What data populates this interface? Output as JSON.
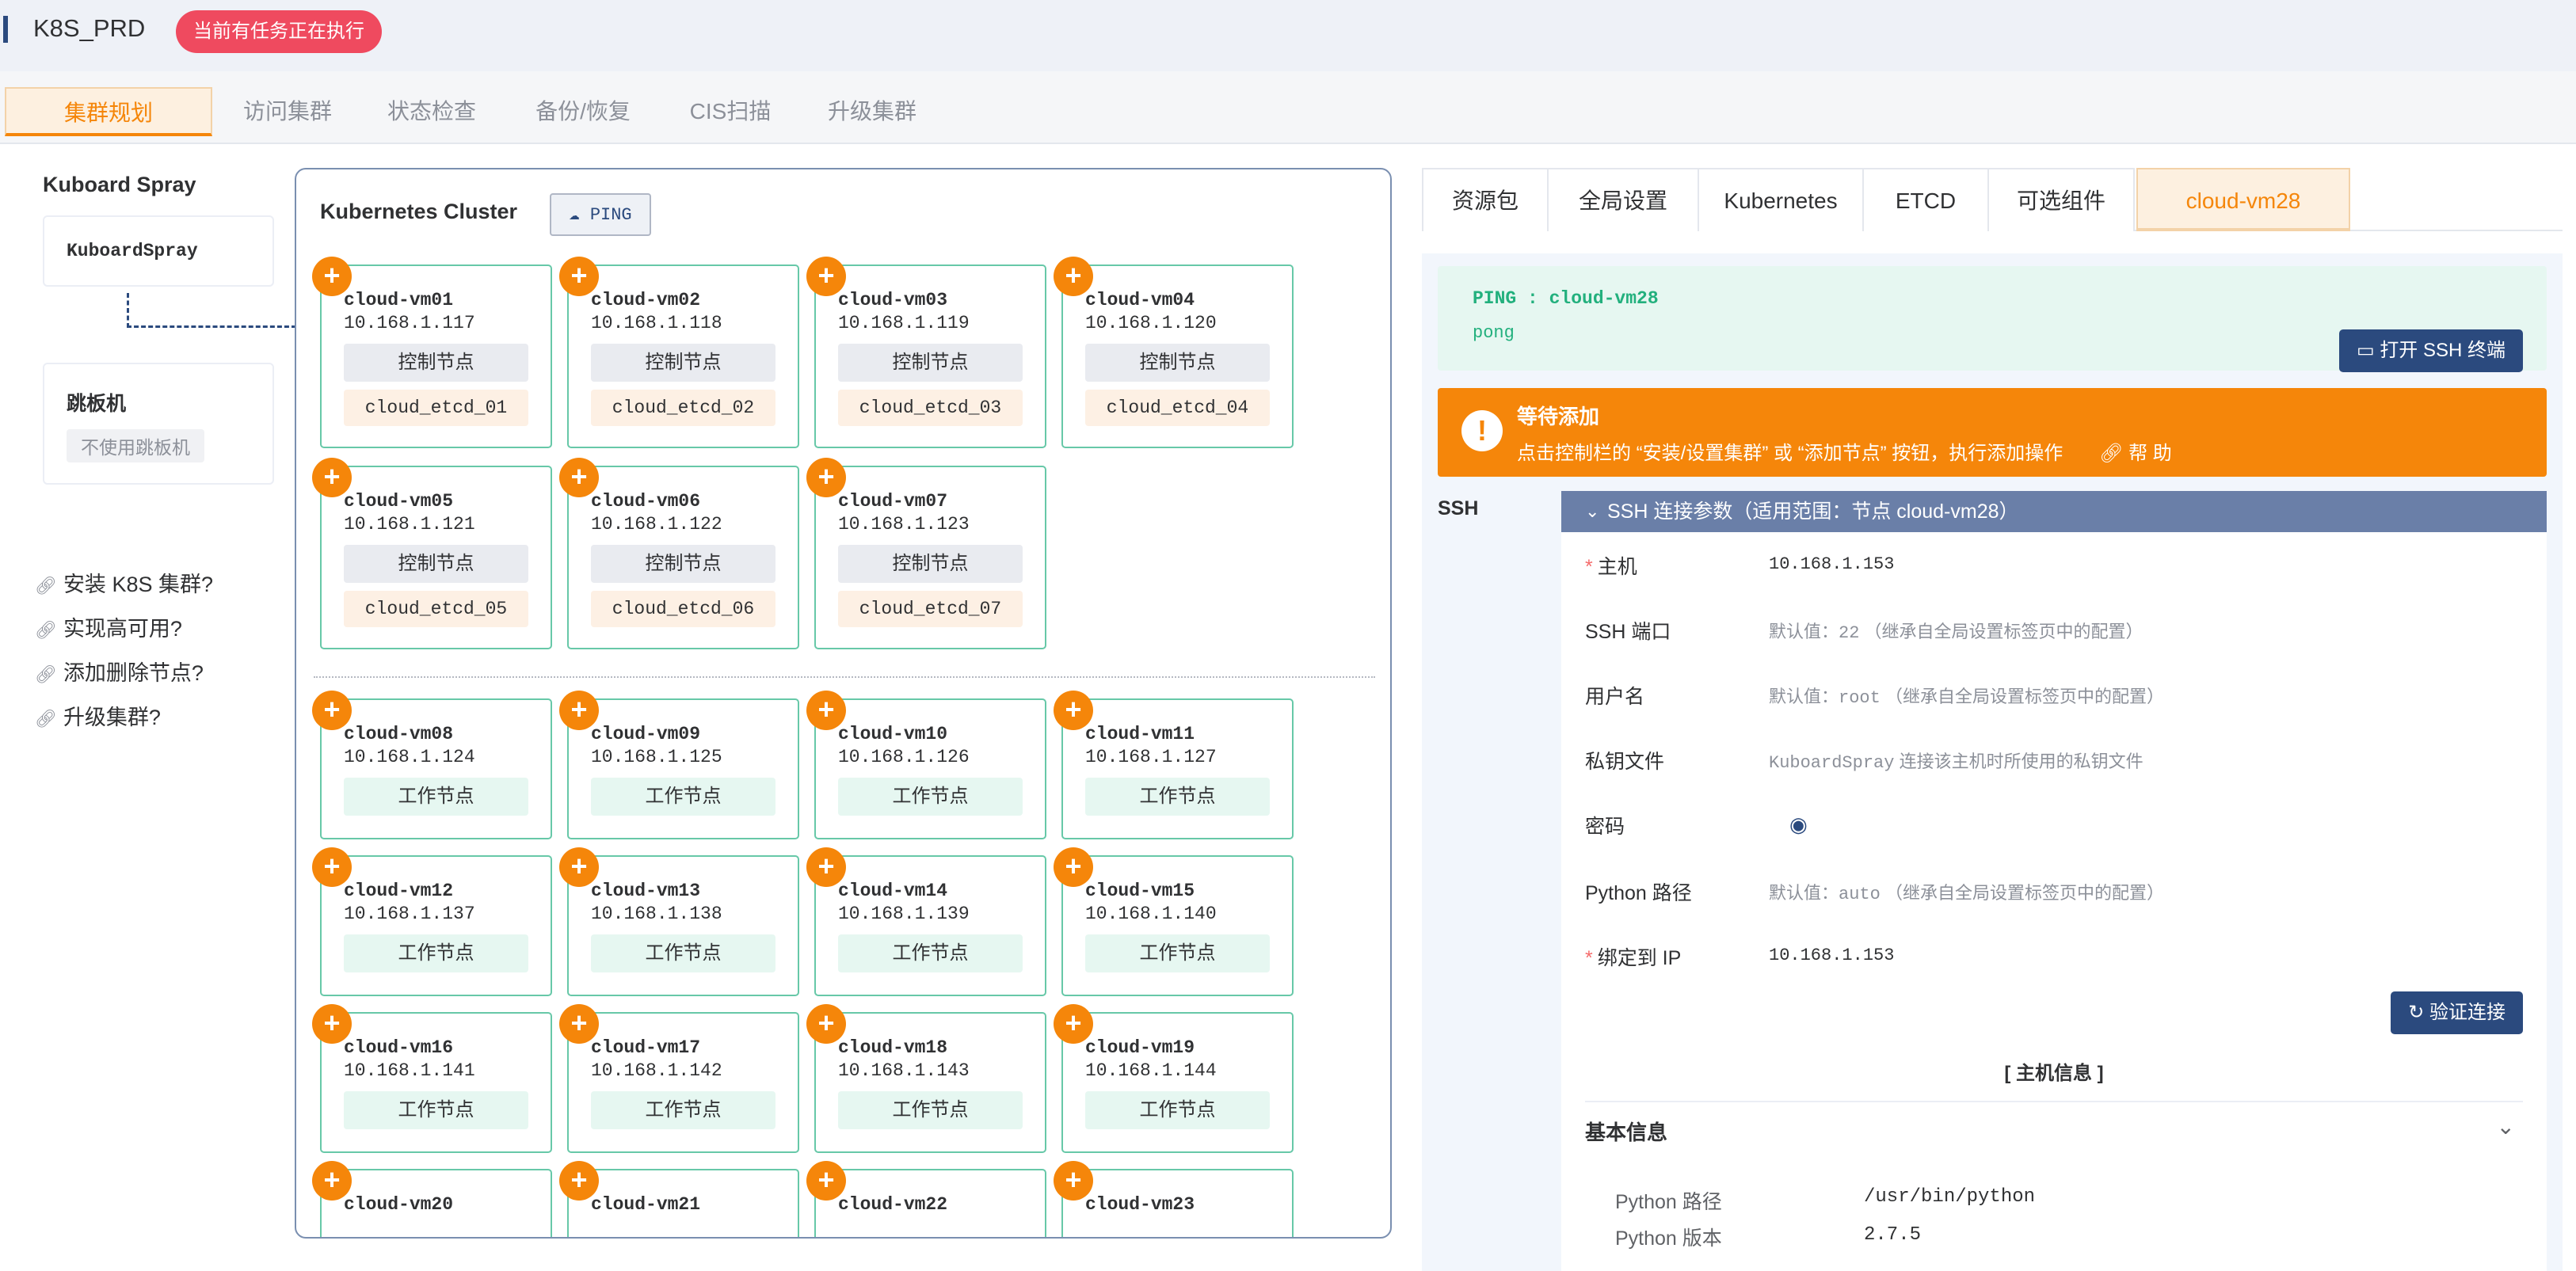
{
  "header": {
    "title": "K8S_PRD",
    "badge": "当前有任务正在执行"
  },
  "top_tabs": [
    "集群规划",
    "访问集群",
    "状态检查",
    "备份/恢复",
    "CIS扫描",
    "升级集群"
  ],
  "left": {
    "title": "Kuboard Spray",
    "kuboardspray_box": "KuboardSpray",
    "jump_title": "跳板机",
    "jump_tag": "不使用跳板机",
    "links": [
      "安装 K8S 集群?",
      "实现高可用?",
      "添加删除节点?",
      "升级集群?"
    ]
  },
  "cluster": {
    "title": "Kubernetes Cluster",
    "ping_label": "PING",
    "control_nodes": [
      {
        "name": "cloud-vm01",
        "ip": "10.168.1.117",
        "role": "控制节点",
        "etcd": "cloud_etcd_01"
      },
      {
        "name": "cloud-vm02",
        "ip": "10.168.1.118",
        "role": "控制节点",
        "etcd": "cloud_etcd_02"
      },
      {
        "name": "cloud-vm03",
        "ip": "10.168.1.119",
        "role": "控制节点",
        "etcd": "cloud_etcd_03"
      },
      {
        "name": "cloud-vm04",
        "ip": "10.168.1.120",
        "role": "控制节点",
        "etcd": "cloud_etcd_04"
      },
      {
        "name": "cloud-vm05",
        "ip": "10.168.1.121",
        "role": "控制节点",
        "etcd": "cloud_etcd_05"
      },
      {
        "name": "cloud-vm06",
        "ip": "10.168.1.122",
        "role": "控制节点",
        "etcd": "cloud_etcd_06"
      },
      {
        "name": "cloud-vm07",
        "ip": "10.168.1.123",
        "role": "控制节点",
        "etcd": "cloud_etcd_07"
      }
    ],
    "worker_nodes": [
      {
        "name": "cloud-vm08",
        "ip": "10.168.1.124",
        "role": "工作节点"
      },
      {
        "name": "cloud-vm09",
        "ip": "10.168.1.125",
        "role": "工作节点"
      },
      {
        "name": "cloud-vm10",
        "ip": "10.168.1.126",
        "role": "工作节点"
      },
      {
        "name": "cloud-vm11",
        "ip": "10.168.1.127",
        "role": "工作节点"
      },
      {
        "name": "cloud-vm12",
        "ip": "10.168.1.137",
        "role": "工作节点"
      },
      {
        "name": "cloud-vm13",
        "ip": "10.168.1.138",
        "role": "工作节点"
      },
      {
        "name": "cloud-vm14",
        "ip": "10.168.1.139",
        "role": "工作节点"
      },
      {
        "name": "cloud-vm15",
        "ip": "10.168.1.140",
        "role": "工作节点"
      },
      {
        "name": "cloud-vm16",
        "ip": "10.168.1.141",
        "role": "工作节点"
      },
      {
        "name": "cloud-vm17",
        "ip": "10.168.1.142",
        "role": "工作节点"
      },
      {
        "name": "cloud-vm18",
        "ip": "10.168.1.143",
        "role": "工作节点"
      },
      {
        "name": "cloud-vm19",
        "ip": "10.168.1.144",
        "role": "工作节点"
      },
      {
        "name": "cloud-vm20",
        "ip": "",
        "role": ""
      },
      {
        "name": "cloud-vm21",
        "ip": "",
        "role": ""
      },
      {
        "name": "cloud-vm22",
        "ip": "",
        "role": ""
      },
      {
        "name": "cloud-vm23",
        "ip": "",
        "role": ""
      }
    ]
  },
  "right_tabs": [
    "资源包",
    "全局设置",
    "Kubernetes",
    "ETCD",
    "可选组件",
    "cloud-vm28"
  ],
  "ping_result": {
    "title": "PING : cloud-vm28",
    "result": "pong",
    "ssh_button": "打开 SSH 终端"
  },
  "warning": {
    "title": "等待添加",
    "desc": "点击控制栏的 “安装/设置集群” 或 “添加节点” 按钮，执行添加操作",
    "help": "帮 助"
  },
  "ssh": {
    "label": "SSH",
    "section_title": "SSH 连接参数（适用范围：节点 cloud-vm28）",
    "host_label": "主机",
    "host_value": "10.168.1.153",
    "port_label": "SSH 端口",
    "port_pre": "默认值：",
    "port_val": "22",
    "port_post": "（继承自全局设置标签页中的配置）",
    "user_label": "用户名",
    "user_pre": "默认值：",
    "user_val": "root",
    "user_post": "（继承自全局设置标签页中的配置）",
    "key_label": "私钥文件",
    "key_pre": "KuboardSpray",
    "key_post": "连接该主机时所使用的私钥文件",
    "pwd_label": "密码",
    "py_label": "Python 路径",
    "py_pre": "默认值：",
    "py_val": "auto",
    "py_post": "（继承自全局设置标签页中的配置）",
    "bind_label": "绑定到 IP",
    "bind_value": "10.168.1.153",
    "verify_button": "验证连接"
  },
  "host_info": {
    "title": "[ 主机信息 ]",
    "basic_title": "基本信息",
    "rows": [
      {
        "label": "Python 路径",
        "value": "/usr/bin/python"
      },
      {
        "label": "Python 版本",
        "value": "2.7.5"
      }
    ]
  },
  "colors": {
    "accent": "#f5860a",
    "primary": "#2b4a7e",
    "success": "#22b07d",
    "danger": "#ef4a5f"
  }
}
